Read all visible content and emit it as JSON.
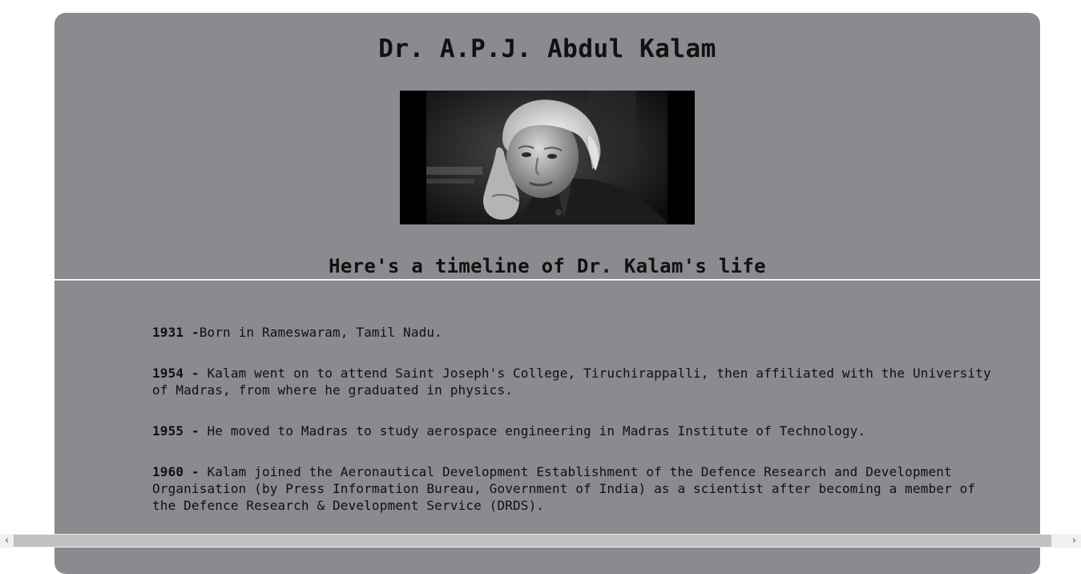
{
  "page": {
    "title": "Dr. A.P.J. Abdul Kalam",
    "subtitle": "Here's a timeline of Dr. Kalam's life"
  },
  "image": {
    "icon": "portrait-photo",
    "description_tone": "black-and-white"
  },
  "timeline": [
    {
      "year": "1931 -",
      "text": "Born in Rameswaram, Tamil Nadu."
    },
    {
      "year": "1954 -",
      "text": " Kalam went on to attend Saint Joseph's College, Tiruchirappalli, then affiliated with the University of Madras, from where he graduated in physics."
    },
    {
      "year": "1955 -",
      "text": " He moved to Madras to study aerospace engineering in Madras Institute of Technology."
    },
    {
      "year": "1960 -",
      "text": " Kalam joined the Aeronautical Development Establishment of the Defence Research and Development Organisation (by Press Information Bureau, Government of India) as a scientist after becoming a member of the Defence Research & Development Service (DRDS)."
    }
  ],
  "scrollbar": {
    "left_icon": "chevron-left-icon",
    "right_icon": "chevron-right-icon",
    "left_glyph": "‹",
    "right_glyph": "›"
  },
  "colors": {
    "card_background": "#8a8a8f",
    "page_background": "#ffffff",
    "divider": "#f4f4f4",
    "text": "#111111"
  }
}
